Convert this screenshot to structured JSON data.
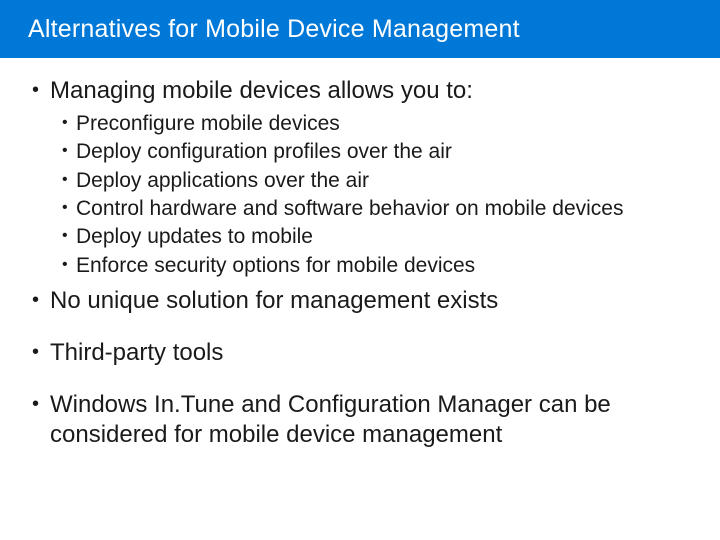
{
  "title": "Alternatives for Mobile Device Management",
  "bullets": {
    "b0": {
      "text": "Managing mobile devices allows you to:",
      "sub": [
        "Preconfigure mobile devices",
        "Deploy configuration profiles over the air",
        "Deploy applications over the air",
        "Control hardware and software behavior on mobile devices",
        "Deploy updates to mobile",
        "Enforce security options for mobile devices"
      ]
    },
    "b1": {
      "text": "No unique solution for management exists"
    },
    "b2": {
      "text": "Third-party tools"
    },
    "b3": {
      "text": "Windows In.Tune and Configuration Manager can be considered for mobile device management"
    }
  }
}
